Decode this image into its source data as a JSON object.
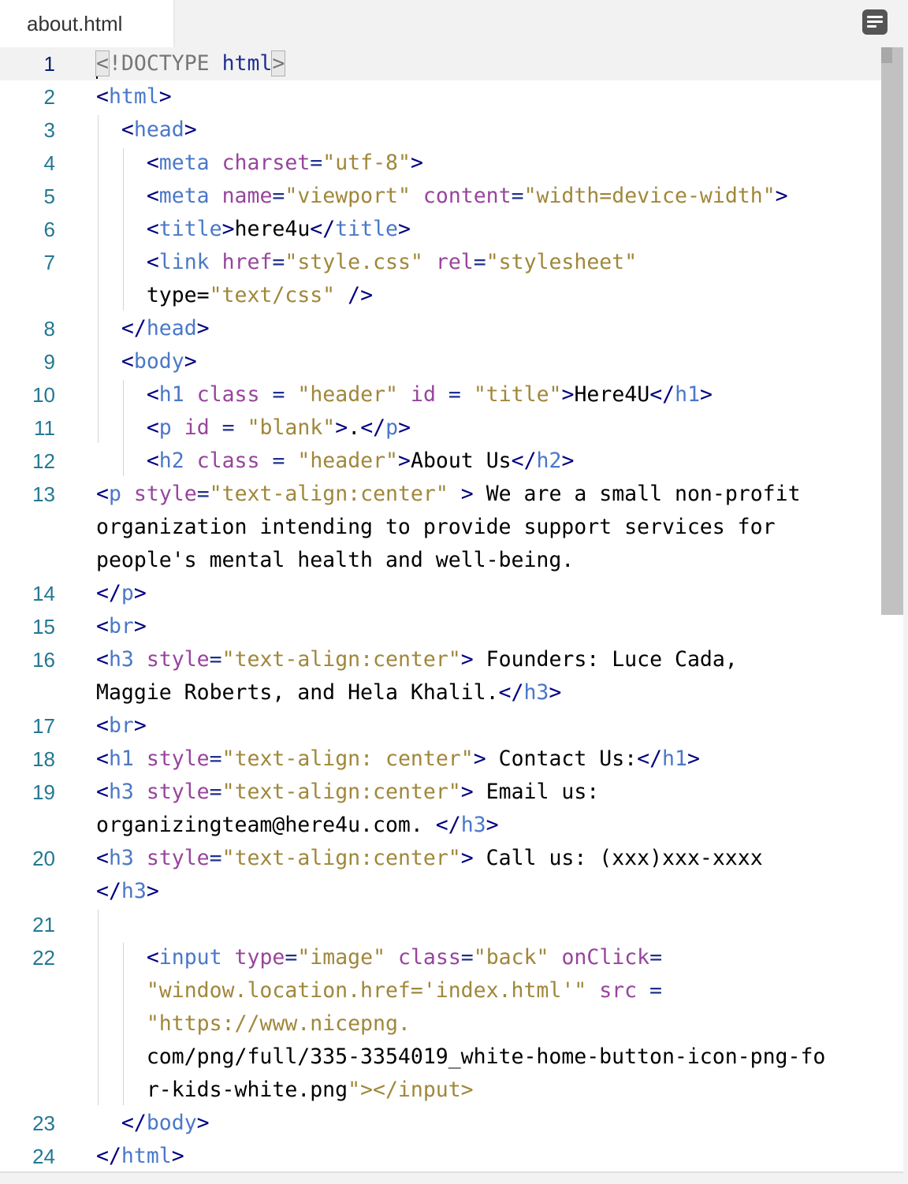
{
  "tab": {
    "filename": "about.html"
  },
  "lines": [
    {
      "n": "1",
      "html": "DOCTYPE"
    },
    {
      "n": "2",
      "text": "<html>"
    },
    {
      "n": "3",
      "text": "  <head>"
    },
    {
      "n": "4",
      "text": "    <meta charset=\"utf-8\">"
    },
    {
      "n": "5",
      "text": "    <meta name=\"viewport\" content=\"width=device-width\">"
    },
    {
      "n": "6",
      "text": "    <title>here4u</title>"
    },
    {
      "n": "7",
      "text": "    <link href=\"style.css\" rel=\"stylesheet\""
    },
    {
      "n": "",
      "text": "    type=\"text/css\" />"
    },
    {
      "n": "8",
      "text": "  </head>"
    },
    {
      "n": "9",
      "text": "  <body>"
    },
    {
      "n": "10",
      "text": "    <h1 class = \"header\" id = \"title\">Here4U</h1>"
    },
    {
      "n": "11",
      "text": "    <p id = \"blank\">.</p>"
    },
    {
      "n": "12",
      "text": "    <h2 class = \"header\">About Us</h2>"
    },
    {
      "n": "13",
      "text": "<p style=\"text-align:center\" > We are a small non-profit"
    },
    {
      "n": "",
      "text": "organization intending to provide support services for"
    },
    {
      "n": "",
      "text": "people's mental health and well-being."
    },
    {
      "n": "14",
      "text": "</p>"
    },
    {
      "n": "15",
      "text": "<br>"
    },
    {
      "n": "16",
      "text": "<h3 style=\"text-align:center\"> Founders: Luce Cada,"
    },
    {
      "n": "",
      "text": "Maggie Roberts, and Hela Khalil.</h3>"
    },
    {
      "n": "17",
      "text": "<br>"
    },
    {
      "n": "18",
      "text": "<h1 style=\"text-align: center\"> Contact Us:</h1>"
    },
    {
      "n": "19",
      "text": "<h3 style=\"text-align:center\"> Email us:"
    },
    {
      "n": "",
      "text": "organizingteam@here4u.com. </h3>"
    },
    {
      "n": "20",
      "text": "<h3 style=\"text-align:center\"> Call us: (xxx)xxx-xxxx"
    },
    {
      "n": "",
      "text": "</h3>"
    },
    {
      "n": "21",
      "text": ""
    },
    {
      "n": "22",
      "text": "    <input type=\"image\" class=\"back\" onClick="
    },
    {
      "n": "",
      "text": "    \"window.location.href='index.html'\" src ="
    },
    {
      "n": "",
      "text": "    \"https://www.nicepng."
    },
    {
      "n": "",
      "text": "    com/png/full/335-3354019_white-home-button-icon-png-fo"
    },
    {
      "n": "",
      "text": "    r-kids-white.png\"></input>"
    },
    {
      "n": "23",
      "text": "  </body>"
    },
    {
      "n": "24",
      "text": "</html>"
    }
  ],
  "doctype_text": "<!DOCTYPE html>",
  "icons": {
    "menu": "menu-lines-icon"
  }
}
